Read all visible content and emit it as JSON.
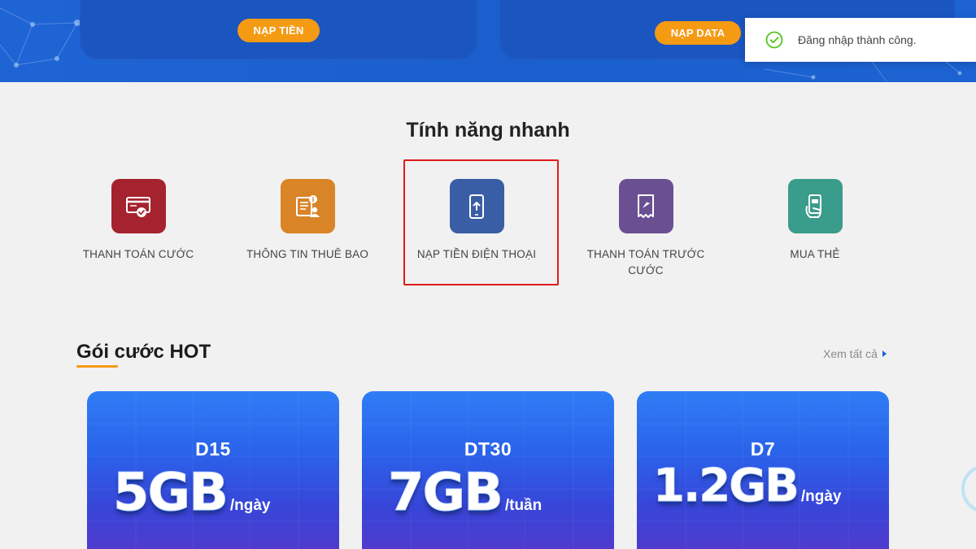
{
  "banner": {
    "left_button_label": "NẠP TIỀN",
    "right_button_label": "NẠP DATA"
  },
  "toast": {
    "message": "Đăng nhập thành công.",
    "icon": "check-circle-icon",
    "color": "#52c41a"
  },
  "quick_features": {
    "title": "Tính năng nhanh",
    "items": [
      {
        "label": "THANH TOÁN CƯỚC",
        "icon": "card-check-icon",
        "color": "#a5232e"
      },
      {
        "label": "THÔNG TIN THUÊ BAO",
        "icon": "subscriber-info-icon",
        "color": "#d88427"
      },
      {
        "label": "NẠP TIỀN ĐIỆN THOẠI",
        "icon": "phone-topup-icon",
        "color": "#3a5ea5"
      },
      {
        "label": "THANH TOÁN TRƯỚC CƯỚC",
        "icon": "receipt-icon",
        "color": "#6b4f93"
      },
      {
        "label": "MUA THẺ",
        "icon": "buy-card-icon",
        "color": "#3a9c8a"
      }
    ],
    "highlighted_index": 2,
    "highlight_color": "#e01b1b"
  },
  "hot_packages": {
    "title": "Gói cước HOT",
    "view_all_label": "Xem tất cả",
    "accent_color": "#f59a13",
    "items": [
      {
        "code": "D15",
        "amount": "5GB",
        "unit": "/ngày"
      },
      {
        "code": "DT30",
        "amount": "7GB",
        "unit": "/tuần"
      },
      {
        "code": "D7",
        "amount": "1.2GB",
        "unit": "/ngày"
      }
    ]
  }
}
